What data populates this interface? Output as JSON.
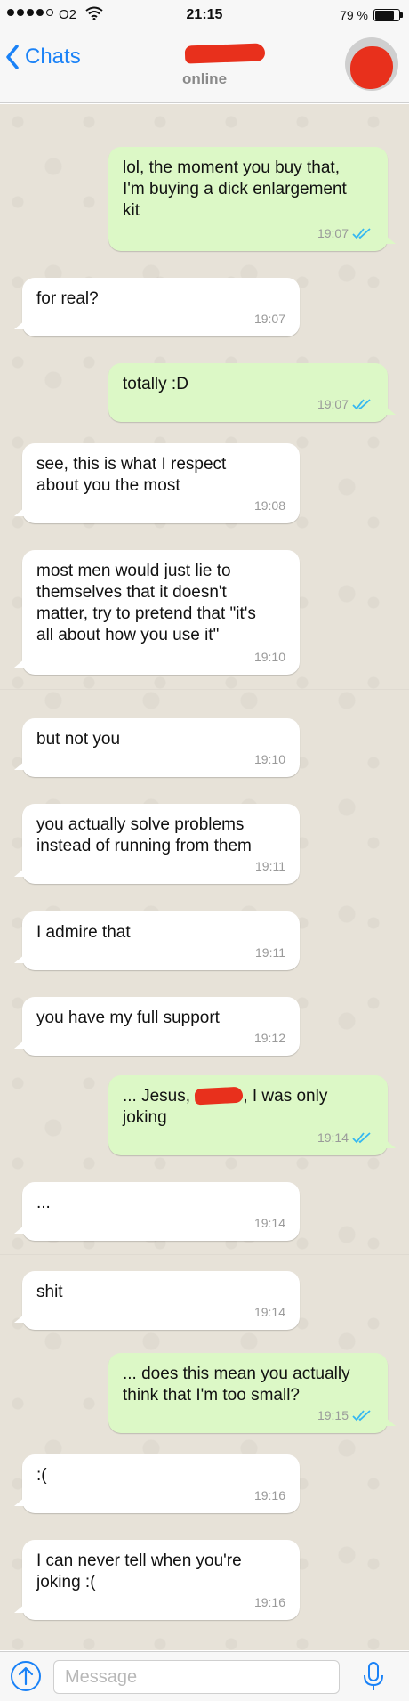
{
  "status_bar": {
    "carrier": "O2",
    "time": "21:15",
    "battery_percent": "79 %",
    "battery_level": 0.79
  },
  "header": {
    "back_label": "Chats",
    "contact_status": "online"
  },
  "messages": [
    {
      "dir": "out",
      "text": "lol, the moment you buy that,\nI'm buying a dick enlargement\nkit",
      "time": "19:07",
      "read": true
    },
    {
      "dir": "in",
      "text": "for real?",
      "time": "19:07"
    },
    {
      "dir": "out",
      "text": "totally :D",
      "time": "19:07",
      "read": true
    },
    {
      "dir": "in",
      "text": "see, this is what I respect\nabout you the most",
      "time": "19:08"
    },
    {
      "dir": "in",
      "text": "most men would just lie to\nthemselves that it doesn't\nmatter, try to pretend that \"it's\nall about how you use it\"",
      "time": "19:10"
    },
    {
      "dir": "in",
      "text": "but not you",
      "time": "19:10"
    },
    {
      "dir": "in",
      "text": "you actually solve problems\ninstead of running from them",
      "time": "19:11"
    },
    {
      "dir": "in",
      "text": "I admire that",
      "time": "19:11"
    },
    {
      "dir": "in",
      "text": "you have my full support",
      "time": "19:12"
    },
    {
      "dir": "out",
      "text_before": "... Jesus, ",
      "text_after": ", I was only\njoking",
      "time": "19:14",
      "read": true
    },
    {
      "dir": "in",
      "text": "...",
      "time": "19:14"
    },
    {
      "dir": "in",
      "text": "shit",
      "time": "19:14"
    },
    {
      "dir": "out",
      "text": "... does this mean you actually\nthink that I'm too small?",
      "time": "19:15",
      "read": true
    },
    {
      "dir": "in",
      "text": ":(",
      "time": "19:16"
    },
    {
      "dir": "in",
      "text": "I can never tell when you're\njoking :(",
      "time": "19:16"
    }
  ],
  "input": {
    "placeholder": "Message"
  },
  "colors": {
    "accent": "#1a82f7",
    "outgoing_bubble": "#dcf8c6",
    "incoming_bubble": "#ffffff",
    "read_ticks": "#34b7f1",
    "redaction": "#e8301c"
  }
}
